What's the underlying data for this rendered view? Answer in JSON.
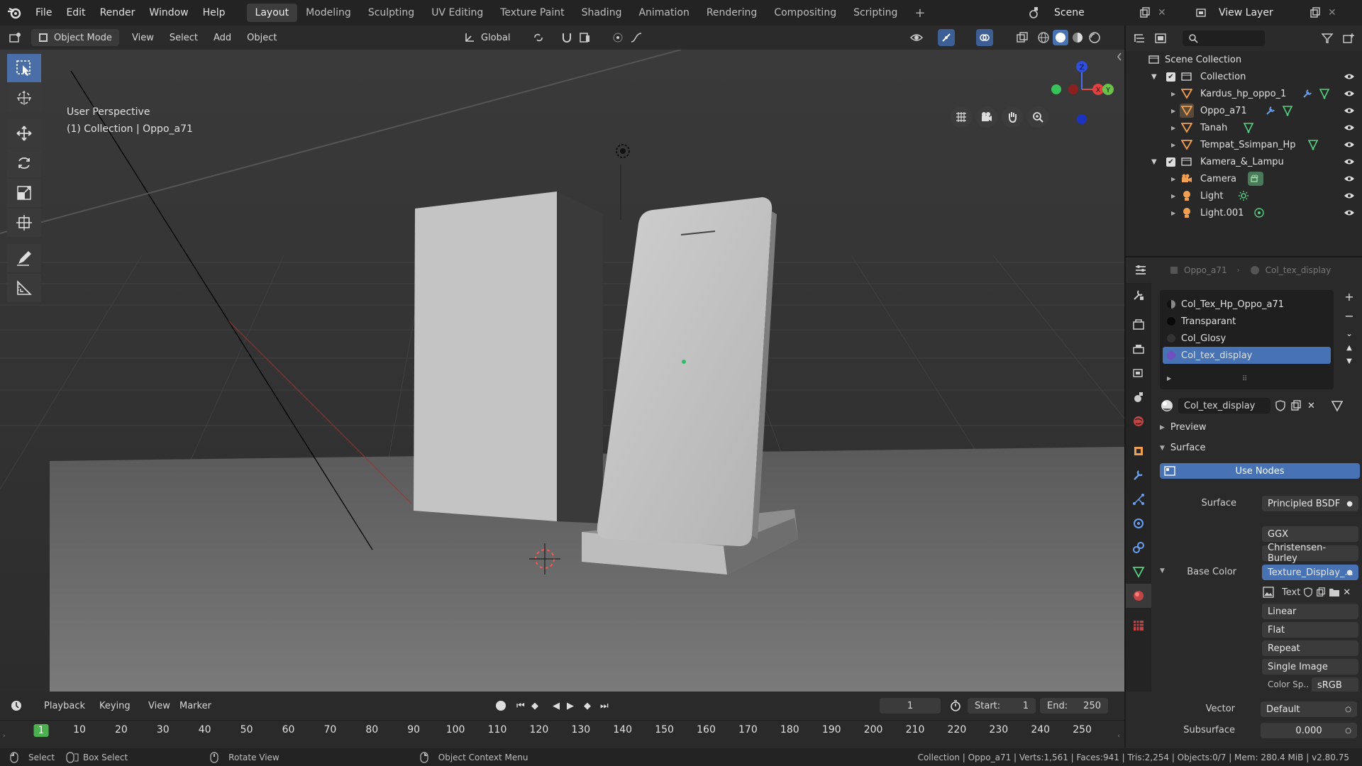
{
  "topbar": {
    "menus": [
      "File",
      "Edit",
      "Render",
      "Window",
      "Help"
    ],
    "workspaces": [
      "Layout",
      "Modeling",
      "Sculpting",
      "UV Editing",
      "Texture Paint",
      "Shading",
      "Animation",
      "Rendering",
      "Compositing",
      "Scripting"
    ],
    "active_workspace": "Layout",
    "scene": "Scene",
    "view_layer": "View Layer"
  },
  "viewport_header": {
    "mode": "Object Mode",
    "menus": [
      "View",
      "Select",
      "Add",
      "Object"
    ],
    "transform_orientation": "Global"
  },
  "viewport": {
    "perspective_label": "User Perspective",
    "collection_label": "(1) Collection | Oppo_a71",
    "gizmo_axes": {
      "x": "X",
      "y": "Y",
      "z": "Z"
    }
  },
  "outliner": {
    "root": "Scene Collection",
    "items": [
      {
        "label": "Collection"
      },
      {
        "label": "Kardus_hp_oppo_1"
      },
      {
        "label": "Oppo_a71"
      },
      {
        "label": "Tanah"
      },
      {
        "label": "Tempat_Ssimpan_Hp"
      },
      {
        "label": "Kamera_&_Lampu"
      },
      {
        "label": "Camera"
      },
      {
        "label": "Light"
      },
      {
        "label": "Light.001"
      }
    ]
  },
  "properties": {
    "breadcrumb_object": "Oppo_a71",
    "breadcrumb_material": "Col_tex_display",
    "slots": [
      "Col_Tex_Hp_Oppo_a71",
      "Transparant",
      "Col_Glosy",
      "Col_tex_display"
    ],
    "material_name": "Col_tex_display",
    "preview_label": "Preview",
    "surface_section": "Surface",
    "use_nodes": "Use Nodes",
    "surface_label": "Surface",
    "surface_value": "Principled BSDF",
    "distribution": "GGX",
    "subsurface_method": "Christensen-Burley",
    "base_color_label": "Base Color",
    "base_color_value": "Texture_Display_...",
    "image_text": "Text",
    "interpolation": "Linear",
    "projection": "Flat",
    "extension": "Repeat",
    "source": "Single Image",
    "color_space_label": "Color Sp..",
    "color_space_value": "sRGB",
    "vector_label": "Vector",
    "vector_value": "Default",
    "subsurface_label": "Subsurface",
    "subsurface_value": "0.000"
  },
  "timeline": {
    "menus": [
      "Playback",
      "Keying",
      "View",
      "Marker"
    ],
    "current_frame": "1",
    "start_label": "Start:",
    "start_value": "1",
    "end_label": "End:",
    "end_value": "250",
    "ruler": [
      "1",
      "10",
      "20",
      "30",
      "40",
      "50",
      "60",
      "70",
      "80",
      "90",
      "100",
      "110",
      "120",
      "130",
      "140",
      "150",
      "160",
      "170",
      "180",
      "190",
      "200",
      "210",
      "220",
      "230",
      "240",
      "250"
    ]
  },
  "statusbar": {
    "select": "Select",
    "box_select": "Box Select",
    "rotate_view": "Rotate View",
    "context_menu": "Object Context Menu",
    "stats": "Collection | Oppo_a71 | Verts:1,561 | Faces:941 | Tris:2,254 | Objects:0/7 | Mem: 280.4 MiB | v2.80.75"
  },
  "colors": {
    "accent_blue": "#4772b3",
    "timeline_frame": "#4caf50",
    "bg": "#1d1d1d"
  }
}
